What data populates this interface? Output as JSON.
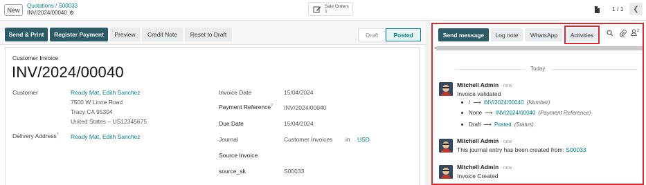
{
  "header": {
    "new_label": "New",
    "breadcrumb_parent": "Quotations",
    "breadcrumb_sep": "/",
    "breadcrumb_ref": "S00033",
    "record_name": "INV/2024/00040",
    "smart_button": {
      "line1": "Sale Orders",
      "line2": "1"
    },
    "pager": "1 / 1"
  },
  "actions": {
    "send_print": "Send & Print",
    "register_payment": "Register Payment",
    "preview": "Preview",
    "credit_note": "Credit Note",
    "reset_draft": "Reset to Draft"
  },
  "statusbar": {
    "draft": "Draft",
    "posted": "Posted"
  },
  "form": {
    "type": "Customer Invoice",
    "number": "INV/2024/00040",
    "customer_label": "Customer",
    "customer_name": "Ready Mat, Edith Sanchez",
    "address_line1": "7500 W Linne Road",
    "address_line2": "Tracy CA 95304",
    "address_line3": "United States – US12345675",
    "delivery_label": "Delivery Address",
    "delivery_q": "?",
    "delivery_value": "Ready Mat, Edith Sanchez",
    "invoice_date_label": "Invoice Date",
    "invoice_date": "15/04/2024",
    "payment_ref_label": "Payment Reference",
    "payment_ref_q": "?",
    "payment_ref": "INV/2024/00040",
    "due_date_label": "Due Date",
    "due_date": "15/04/2024",
    "journal_label": "Journal",
    "journal": "Customer Invoices",
    "journal_in": "in",
    "currency": "USD",
    "source_label": "Source Invoice",
    "source_sk_label": "source_sk",
    "source_sk": "S00033"
  },
  "chatter": {
    "send_message": "Send message",
    "log_note": "Log note",
    "whatsapp": "WhatsApp",
    "activities": "Activities",
    "followers_count": "2",
    "today": "Today",
    "messages": [
      {
        "author": "Mitchell Admin",
        "time": "- now",
        "body": "Invoice validated",
        "tracking": [
          {
            "old": "/",
            "arrow": "⟶",
            "new": "INV/2024/00040",
            "field": "(Number)"
          },
          {
            "old": "None",
            "arrow": "⟶",
            "new": "INV/2024/00040",
            "field": "(Payment Reference)"
          },
          {
            "old": "Draft",
            "arrow": "⟶",
            "new": "Posted",
            "field": "(Status)"
          }
        ]
      },
      {
        "author": "Mitchell Admin",
        "time": "- now",
        "body_prefix": "This journal entry has been created from: ",
        "body_link": "S00033"
      },
      {
        "author": "Mitchell Admin",
        "time": "- now",
        "body": "Invoice Created"
      }
    ]
  },
  "colors": {
    "primary": "#2a5b67",
    "link": "#017e84",
    "highlight": "#d9282f"
  }
}
